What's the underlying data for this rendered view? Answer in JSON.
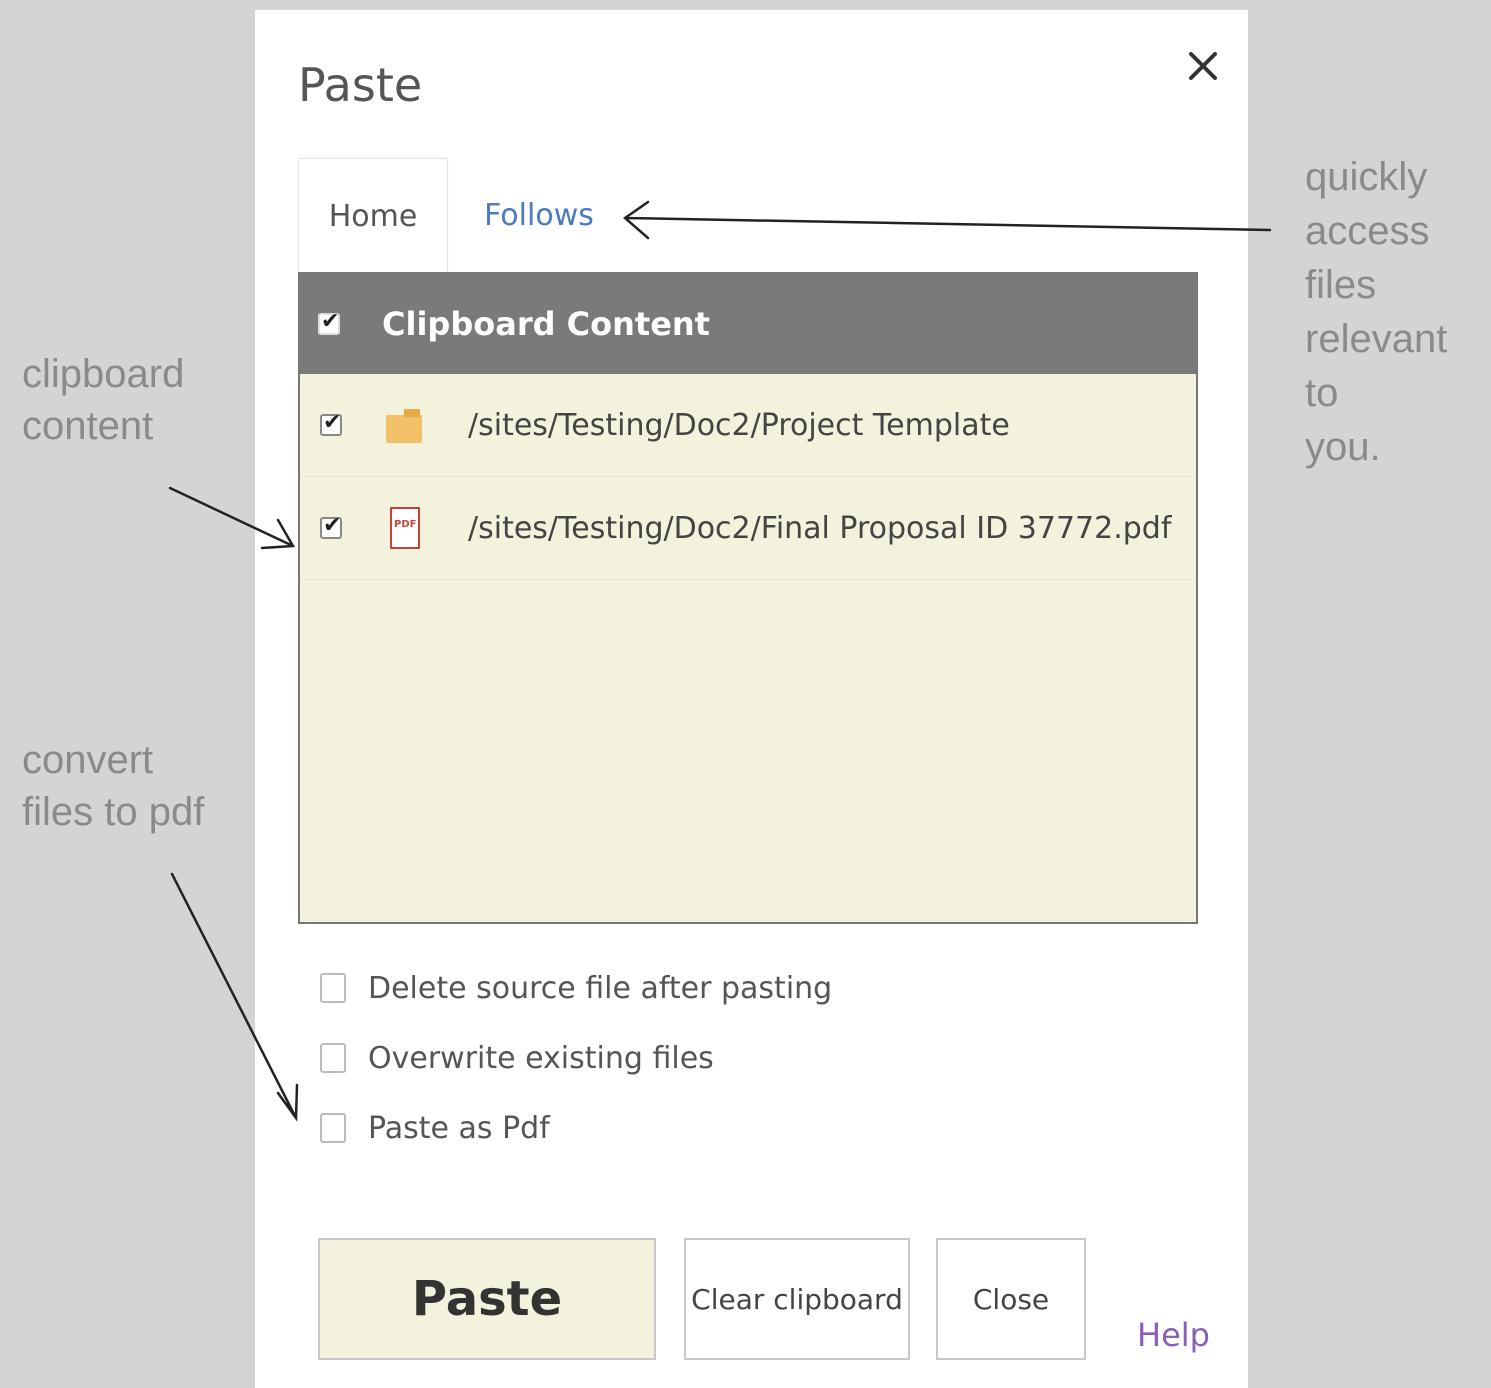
{
  "annotations": {
    "clipboard": [
      "clipboard",
      "content"
    ],
    "convert": [
      "convert",
      "files to pdf"
    ],
    "quick": [
      "quickly",
      "access",
      "files",
      "relevant to",
      "you."
    ]
  },
  "dialog": {
    "title": "Paste",
    "tabs": [
      "Home",
      "Follows"
    ],
    "panel": {
      "header": "Clipboard Content",
      "rows": [
        {
          "path": "/sites/Testing/Doc2/Project Template",
          "icon": "folder-icon",
          "checked": true
        },
        {
          "path": "/sites/Testing/Doc2/Final Proposal ID 37772.pdf",
          "icon": "pdf-icon",
          "checked": true
        }
      ]
    },
    "options": [
      "Delete source file after pasting",
      "Overwrite existing files",
      "Paste as Pdf"
    ],
    "buttons": {
      "paste": "Paste",
      "clear": "Clear clipboard",
      "close": "Close",
      "help": "Help"
    }
  },
  "colors": {
    "panel_bg": "#f3f2dd",
    "header_bg": "#7a7a7a",
    "link": "#4a7bc0",
    "help": "#8a5fb8"
  }
}
